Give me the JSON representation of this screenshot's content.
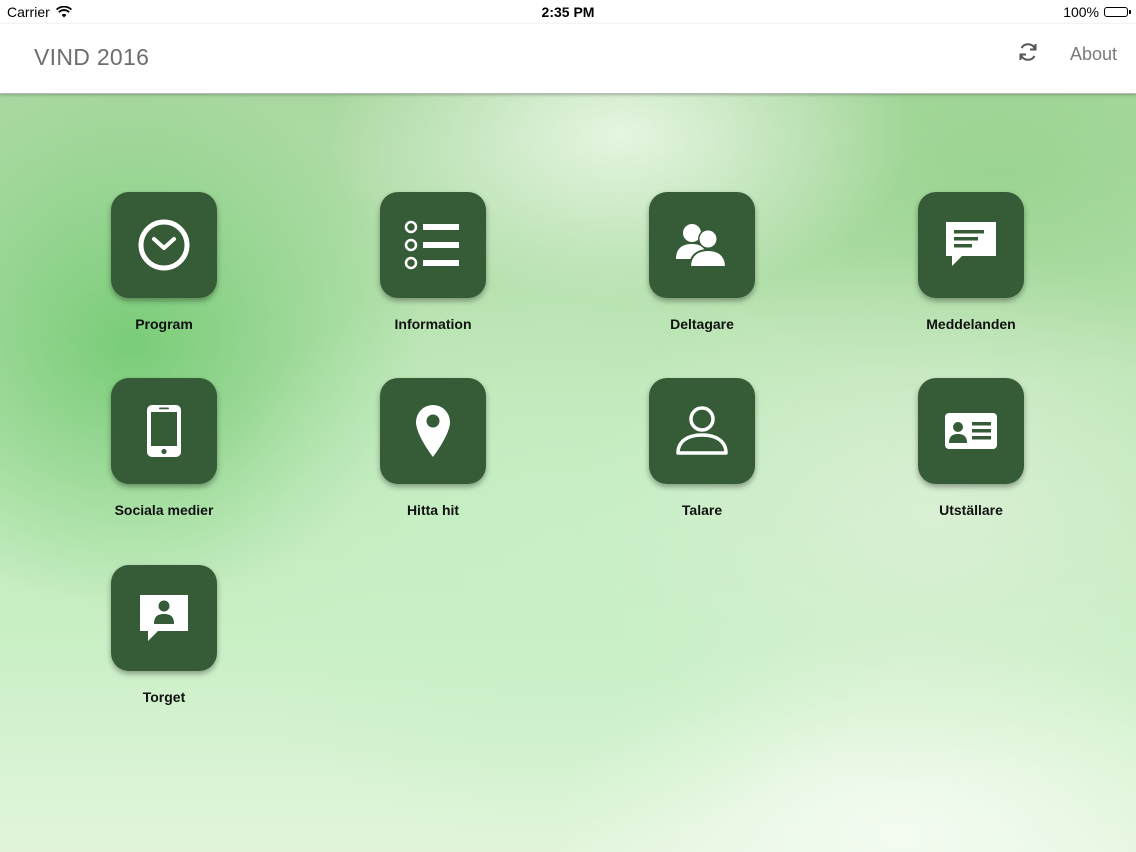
{
  "status_bar": {
    "carrier": "Carrier",
    "time": "2:35 PM",
    "battery": "100%"
  },
  "nav": {
    "title": "VIND 2016",
    "about_label": "About",
    "refresh_icon": "refresh-icon"
  },
  "colors": {
    "tile_bg": "#355c36",
    "tile_icon": "#ffffff",
    "nav_text": "#6e6e6e"
  },
  "grid": {
    "tiles": [
      {
        "label": "Program",
        "icon": "clock-icon"
      },
      {
        "label": "Information",
        "icon": "list-icon"
      },
      {
        "label": "Deltagare",
        "icon": "people-icon"
      },
      {
        "label": "Meddelanden",
        "icon": "message-icon"
      },
      {
        "label": "Sociala medier",
        "icon": "phone-icon"
      },
      {
        "label": "Hitta hit",
        "icon": "location-pin-icon"
      },
      {
        "label": "Talare",
        "icon": "person-icon"
      },
      {
        "label": "Utställare",
        "icon": "id-card-icon"
      },
      {
        "label": "Torget",
        "icon": "chat-person-icon"
      }
    ]
  }
}
